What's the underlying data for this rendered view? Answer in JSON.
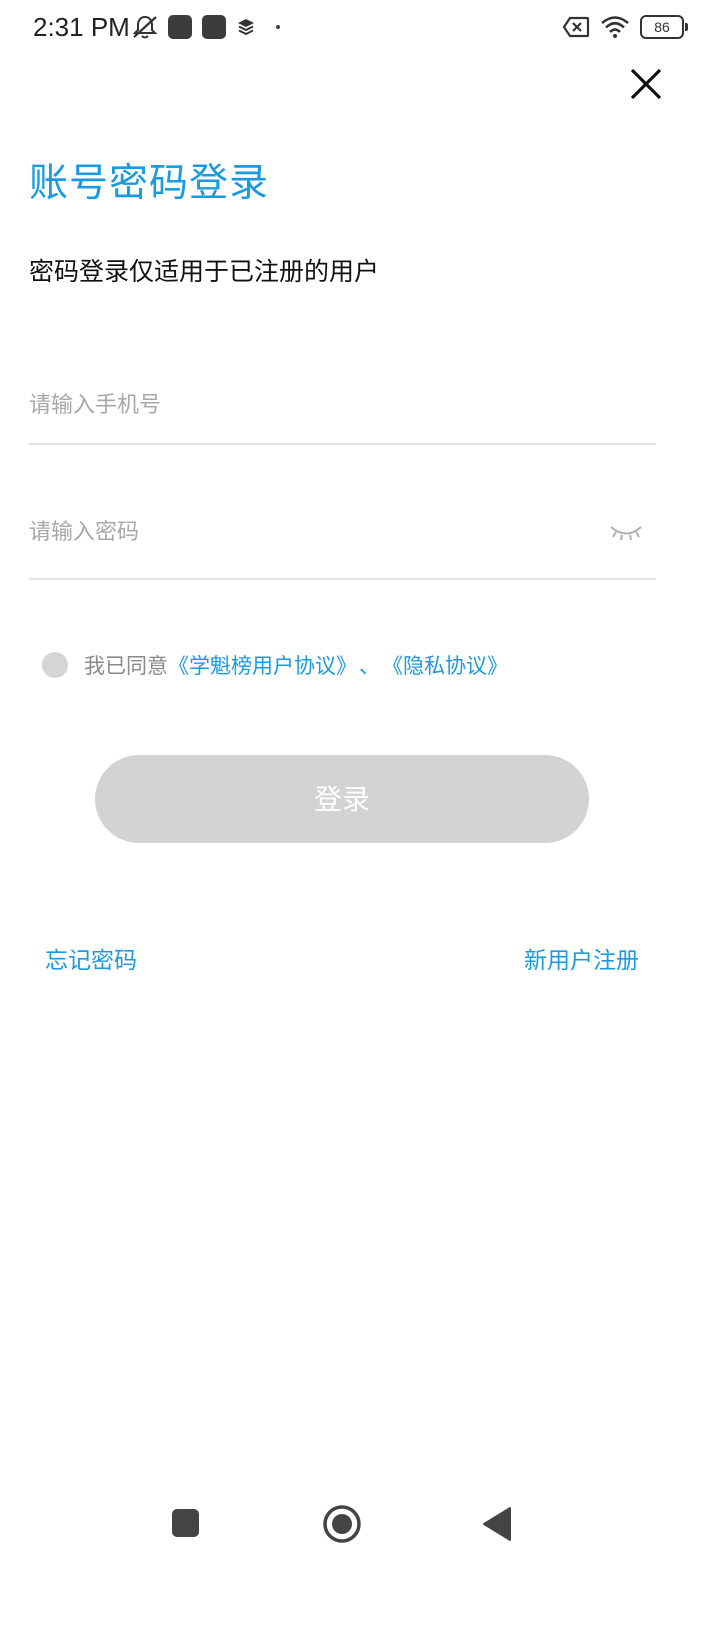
{
  "status_bar": {
    "time": "2:31 PM",
    "battery_level": "86",
    "icons": [
      "mute-icon",
      "app-icon",
      "app-icon",
      "layers-icon",
      "dot-icon",
      "no-sim-icon",
      "wifi-icon",
      "battery-icon"
    ]
  },
  "header": {
    "title": "账号密码登录",
    "subtitle": "密码登录仅适用于已注册的用户"
  },
  "form": {
    "phone_placeholder": "请输入手机号",
    "password_placeholder": "请输入密码",
    "agree_prefix": "我已同意",
    "user_agreement": "《学魁榜用户协议》",
    "separator": "、",
    "privacy_policy": "《隐私协议》",
    "agreed": false
  },
  "actions": {
    "login_label": "登录",
    "forgot_password": "忘记密码",
    "register": "新用户注册"
  },
  "colors": {
    "accent": "#1a9ae0",
    "disabled_button": "#d3d3d3"
  }
}
